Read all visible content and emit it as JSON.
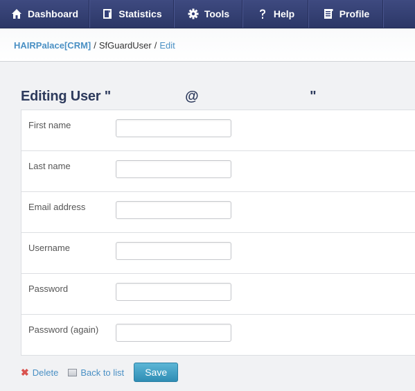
{
  "nav": {
    "items": [
      {
        "label": "Dashboard",
        "icon": "home-icon"
      },
      {
        "label": "Statistics",
        "icon": "book-icon"
      },
      {
        "label": "Tools",
        "icon": "gear-icon"
      },
      {
        "label": "Help",
        "icon": "question-icon"
      },
      {
        "label": "Profile",
        "icon": "document-icon"
      }
    ]
  },
  "breadcrumb": {
    "root": "HAIRPalace[CRM]",
    "separator": "/",
    "middle": "SfGuardUser",
    "current": "Edit"
  },
  "page": {
    "title": "Editing User \"                    @                              \""
  },
  "form": {
    "fields": [
      {
        "label": "First name",
        "value": "",
        "placeholder": ""
      },
      {
        "label": "Last name",
        "value": "",
        "placeholder": ""
      },
      {
        "label": "Email address",
        "value": "",
        "placeholder": ""
      },
      {
        "label": "Username",
        "value": "",
        "placeholder": ""
      },
      {
        "label": "Password",
        "value": "",
        "placeholder": ""
      },
      {
        "label": "Password (again)",
        "value": "",
        "placeholder": ""
      }
    ]
  },
  "actions": {
    "delete_label": "Delete",
    "back_label": "Back to list",
    "save_label": "Save"
  },
  "colors": {
    "nav_bg": "#34407a",
    "link": "#4a90c4",
    "title": "#2d3a5c",
    "save_button": "#3a9cc4",
    "delete_icon": "#d9534f"
  }
}
